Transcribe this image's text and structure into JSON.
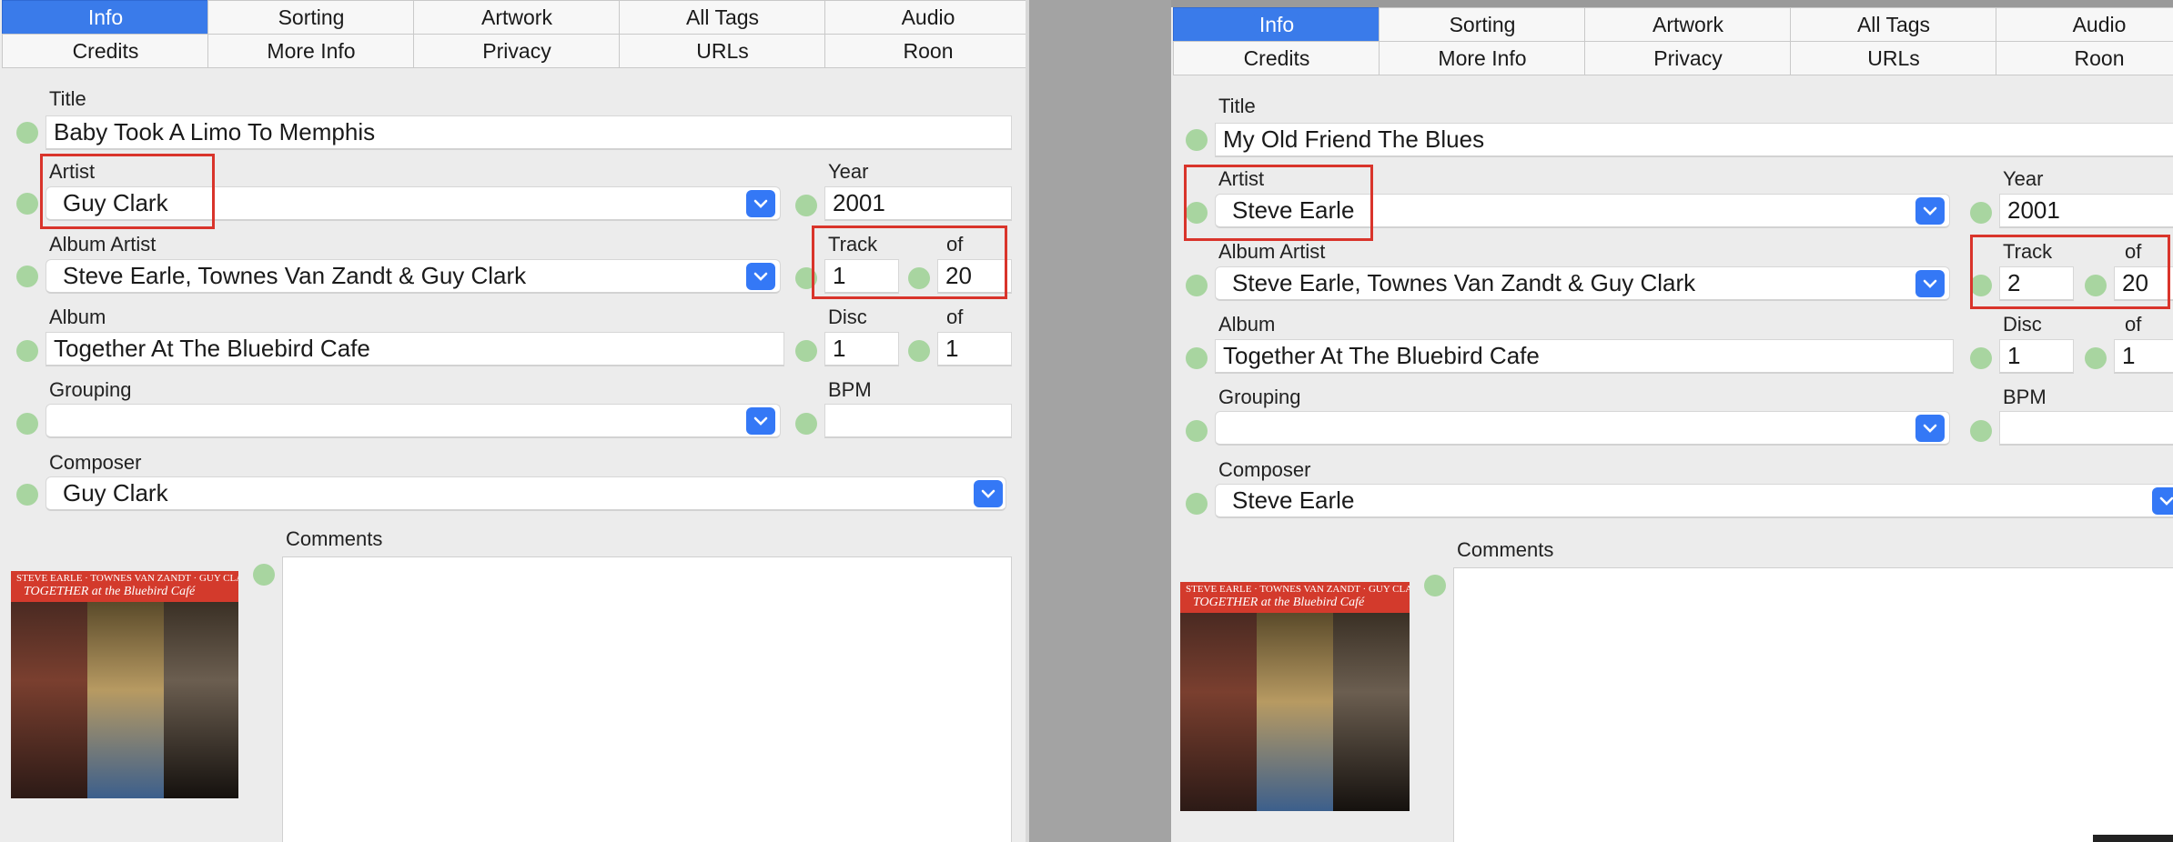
{
  "colors": {
    "accent": "#3a7bea",
    "status_dot": "#a8d5a0",
    "highlight": "#d9342b",
    "window_bg": "#ececec"
  },
  "tabs_row1": [
    "Info",
    "Sorting",
    "Artwork",
    "All Tags",
    "Audio"
  ],
  "tabs_row2": [
    "Credits",
    "More Info",
    "Privacy",
    "URLs",
    "Roon"
  ],
  "labels": {
    "title": "Title",
    "artist": "Artist",
    "album_artist": "Album Artist",
    "album": "Album",
    "grouping": "Grouping",
    "composer": "Composer",
    "year": "Year",
    "track": "Track",
    "of": "of",
    "disc": "Disc",
    "bpm": "BPM",
    "comments": "Comments"
  },
  "left": {
    "title": "Baby Took A Limo To Memphis",
    "artist": "Guy Clark",
    "album_artist": "Steve Earle, Townes Van Zandt & Guy Clark",
    "album": "Together At The Bluebird Cafe",
    "grouping": "",
    "composer": "Guy Clark",
    "year": "2001",
    "track": "1",
    "track_total": "20",
    "disc": "1",
    "disc_total": "1",
    "bpm": "",
    "comments": ""
  },
  "right": {
    "title": "My Old Friend The Blues",
    "artist": "Steve Earle",
    "album_artist": "Steve Earle, Townes Van Zandt & Guy Clark",
    "album": "Together At The Bluebird Cafe",
    "grouping": "",
    "composer": "Steve Earle",
    "year": "2001",
    "track": "2",
    "track_total": "20",
    "disc": "1",
    "disc_total": "1",
    "bpm": "",
    "comments": ""
  },
  "artwork": {
    "line1": "STEVE EARLE · TOWNES VAN ZANDT · GUY CLARK",
    "line2": "TOGETHER at the Bluebird Café"
  }
}
